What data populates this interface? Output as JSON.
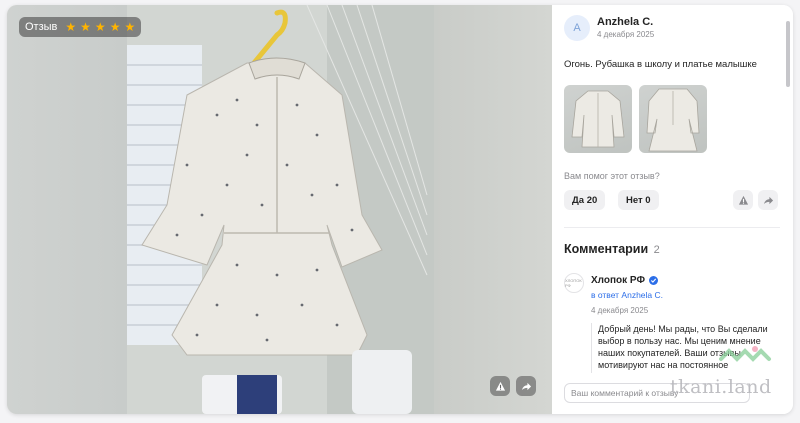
{
  "photo": {
    "badge_label": "Отзыв",
    "rating": 5,
    "stars": [
      "★",
      "★",
      "★",
      "★",
      "★"
    ],
    "buttons": [
      "warning-icon",
      "share-icon"
    ]
  },
  "review": {
    "author": "Anzhela C.",
    "avatar_letter": "A",
    "date": "4 декабря 2025",
    "text": "Огонь. Рубашка в школу и платье малышке",
    "helpful_question": "Вам помог этот отзыв?",
    "yes_label": "Да 20",
    "no_label": "Нет 0"
  },
  "comments": {
    "title": "Комментарии",
    "count": "2",
    "items": [
      {
        "author": "Хлопок РФ",
        "avatar_text": "ХЛОПОК РФ",
        "reply_to": "в ответ Anzhela C.",
        "date": "4 декабря 2025",
        "text": "Добрый день! Мы рады, что Вы сделали выбор в пользу нас. Мы ценим мнение наших покупателей. Ваши отзывы мотивируют нас на постоянное"
      }
    ],
    "input_placeholder": "Ваш комментарий к отзыву"
  },
  "watermark": "tkani.land",
  "colors": {
    "accent": "#2c6ee8",
    "star": "#ffb400",
    "text": "#242424",
    "muted": "#8a8a8e"
  }
}
